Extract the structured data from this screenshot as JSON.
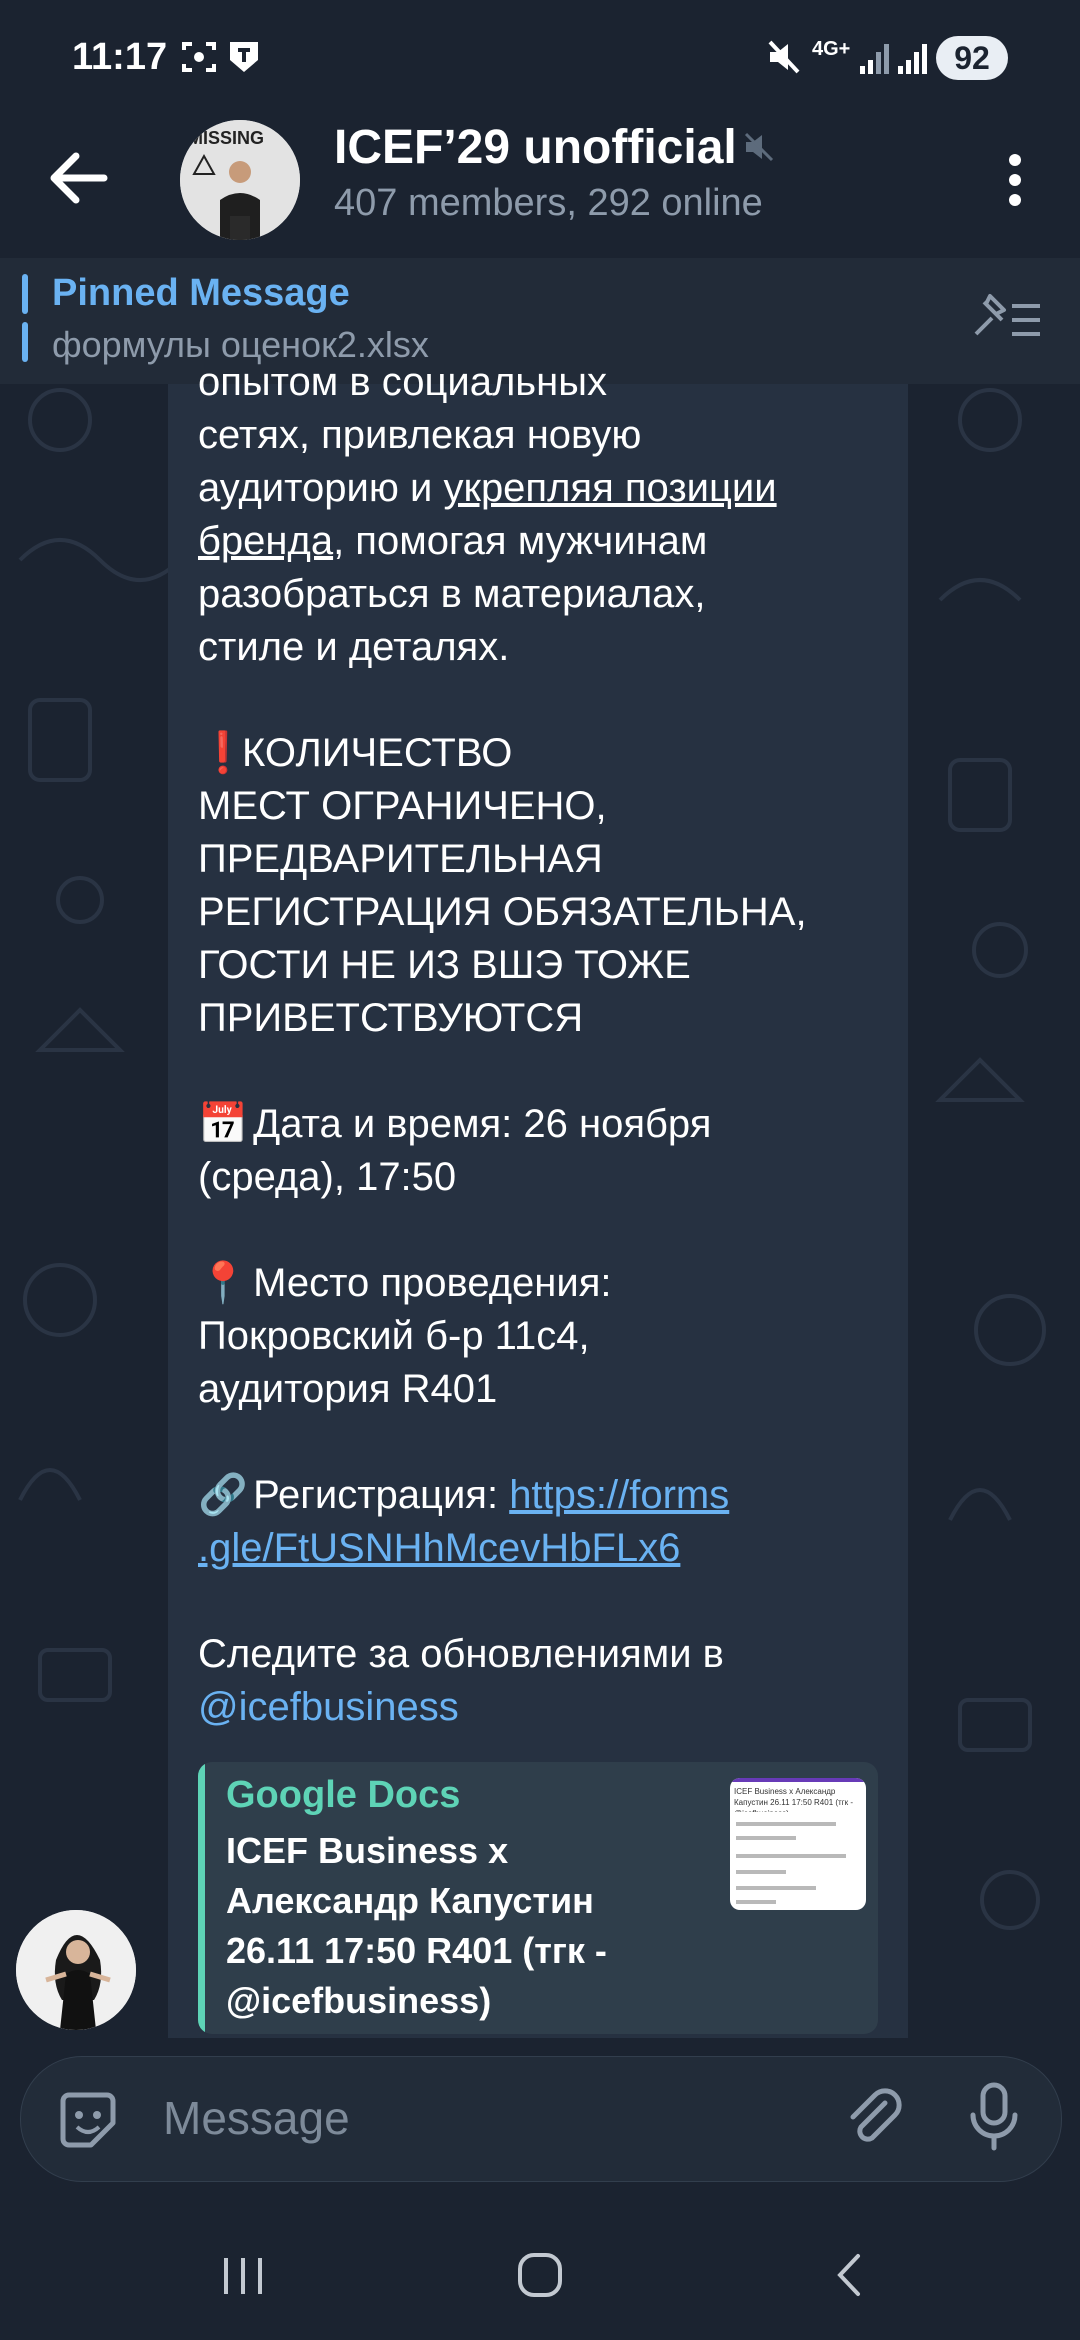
{
  "status_bar": {
    "time": "11:17",
    "network": "4G+",
    "battery": "92",
    "icons": [
      "screenshot-icon",
      "notification-icon",
      "mute-icon",
      "signal-icon",
      "signal-icon",
      "battery-icon"
    ]
  },
  "header": {
    "title": "ICEF’29 unofficial",
    "subtitle": "407 members, 292 online",
    "avatar_text": "MISSING"
  },
  "pinned": {
    "label": "Pinned Message",
    "text": "формулы оценок2.xlsx"
  },
  "message": {
    "line1": "опытом в социальных",
    "line2": "сетях, привлекая новую",
    "line3_a": "аудиторию и ",
    "line3_b": "укрепляя позиции",
    "line4_a": "бренда",
    "line4_b": ", помогая мужчинам",
    "line5": "разобраться в материалах,",
    "line6": "стиле и деталях.",
    "warn_emoji": "❗",
    "warning": "КОЛИЧЕСТВО\nМЕСТ ОГРАНИЧЕНО,\nПРЕДВАРИТЕЛЬНАЯ\nРЕГИСТРАЦИЯ ОБЯЗАТЕЛЬНА,\nГОСТИ НЕ ИЗ ВШЭ ТОЖЕ\nПРИВЕТСТВУЮТСЯ",
    "date_emoji": "📅",
    "date": "Дата и время: 26 ноября\n(среда), 17:50",
    "place_emoji": "📍",
    "place": "Место проведения:\nПокровский б-р 11с4,\nаудитория R401",
    "link_emoji": "🔗",
    "reg_label": "Регистрация: ",
    "reg_link": "https://forms\n.gle/FtUSNHhMcevHbFLx6",
    "follow": "Следите за обновлениями в\n",
    "mention": "@icefbusiness"
  },
  "link_preview": {
    "site": "Google Docs",
    "title": "ICEF Business x\nАлександр Капустин\n26.11 17:50 R401 (тгк -\n@icefbusiness)",
    "thumb_text": "ICEF Business x Александр Капустин 26.11 17:50 R401 (тгк - @icefbusiness)"
  },
  "input": {
    "placeholder": "Message"
  },
  "colors": {
    "background": "#1b2330",
    "bubble": "#263141",
    "accent": "#6ab2f2",
    "preview_accent": "#5ed3b6",
    "muted": "#8e9bab"
  }
}
